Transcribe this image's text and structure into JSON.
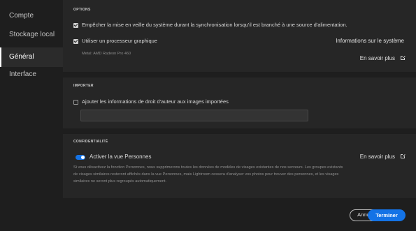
{
  "sidebar": {
    "items": [
      {
        "label": "Compte",
        "active": false
      },
      {
        "label": "Stockage local",
        "active": false
      },
      {
        "label": "Général",
        "active": true
      },
      {
        "label": "Interface",
        "active": false
      }
    ]
  },
  "options": {
    "title": "OPTIONS",
    "prevent_sleep": {
      "label": "Empêcher la mise en veille du système durant la synchronisation lorsqu'il est branché à une source d'alimentation.",
      "checked": true
    },
    "use_gpu": {
      "label": "Utiliser un processeur graphique",
      "checked": true
    },
    "gpu_info": "Metal: AMD Radeon Pro 460",
    "system_info_link": "Informations sur le système",
    "learn_more_link": "En savoir plus"
  },
  "import": {
    "title": "IMPORTER",
    "copyright": {
      "label": "Ajouter les informations de droit d'auteur aux images importées",
      "checked": false
    },
    "copyright_value": ""
  },
  "privacy": {
    "title": "CONFIDENTIALITÉ",
    "people_toggle": {
      "label": "Activer la vue Personnes",
      "on": true
    },
    "learn_more_link": "En savoir plus",
    "description": "Si vous désactivez la fonction Personnes, nous supprimerons toutes les données de modèles de visages existantes de nos serveurs. Les groupes existants de visages similaires resteront affichés dans la vue Personnes, mais Lightroom cessera d'analyser vos photos pour trouver des personnes, et les visages similaires ne seront plus regroupés automatiquement."
  },
  "footer": {
    "cancel_label": "Annuler",
    "done_label": "Terminer"
  },
  "colors": {
    "accent": "#1473e6",
    "panel": "#262626",
    "background": "#1e1e1e"
  }
}
